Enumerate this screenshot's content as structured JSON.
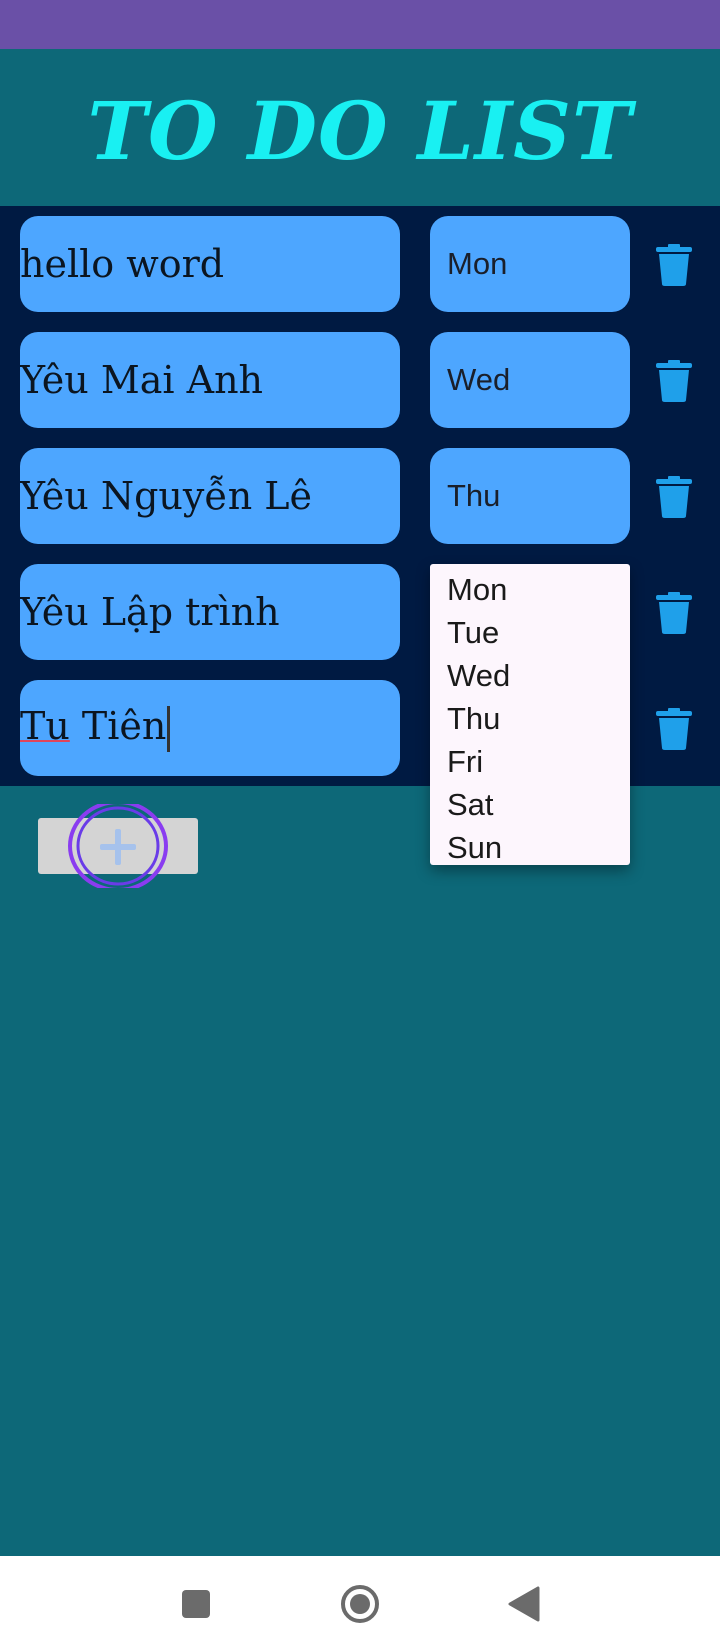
{
  "app": {
    "title": "TO DO LIST"
  },
  "tasks": [
    {
      "text": "hello word",
      "day": "Mon"
    },
    {
      "text": "Yêu Mai Anh",
      "day": "Wed"
    },
    {
      "text": "Yêu Nguyễn Lê",
      "day": "Thu"
    },
    {
      "text": "Yêu Lập trình",
      "day": ""
    },
    {
      "text": "Tu Tiên",
      "day": ""
    }
  ],
  "day_dropdown": {
    "options": [
      "Mon",
      "Tue",
      "Wed",
      "Thu",
      "Fri",
      "Sat",
      "Sun"
    ]
  },
  "icons": {
    "delete": "trash-icon",
    "add": "plus-icon",
    "nav_recents": "square-icon",
    "nav_home": "circle-icon",
    "nav_back": "triangle-back-icon"
  },
  "colors": {
    "status_bar": "#6a50a7",
    "background": "#0d6878",
    "title": "#19f0f2",
    "list_panel": "#001a42",
    "item_fill": "#4da6ff",
    "trash": "#1fa0ea",
    "ripple": "#8a3cf0"
  }
}
